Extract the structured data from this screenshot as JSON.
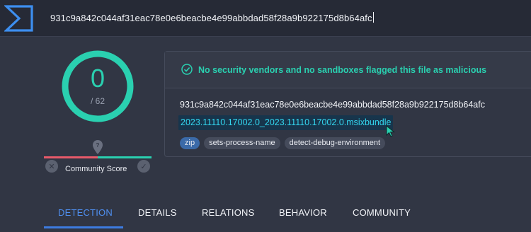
{
  "header": {
    "logo_icon": "virustotal-sigma-logo",
    "search_value": "931c9a842c044af31eac78e0e6beacbe4e99abbdad58f28a9b922175d8b64afc"
  },
  "score": {
    "detections": "0",
    "total": "/ 62",
    "ring_color": "#2ad0b0"
  },
  "community": {
    "label": "Community Score",
    "negative_fraction": 0.5,
    "positive_fraction": 0.5
  },
  "verdict": {
    "icon": "check-circle-icon",
    "text": "No security vendors and no sandboxes flagged this file as malicious",
    "color": "#2ad0b0"
  },
  "file": {
    "hash": "931c9a842c044af31eac78e0e6beacbe4e99abbdad58f28a9b922175d8b64afc",
    "name": "2023.11110.17002.0_2023.11110.17002.0.msixbundle"
  },
  "tags": [
    {
      "label": "zip"
    },
    {
      "label": "sets-process-name"
    },
    {
      "label": "detect-debug-environment"
    }
  ],
  "tabs": [
    {
      "label": "DETECTION",
      "active": true
    },
    {
      "label": "DETAILS",
      "active": false
    },
    {
      "label": "RELATIONS",
      "active": false
    },
    {
      "label": "BEHAVIOR",
      "active": false
    },
    {
      "label": "COMMUNITY",
      "active": false
    }
  ]
}
